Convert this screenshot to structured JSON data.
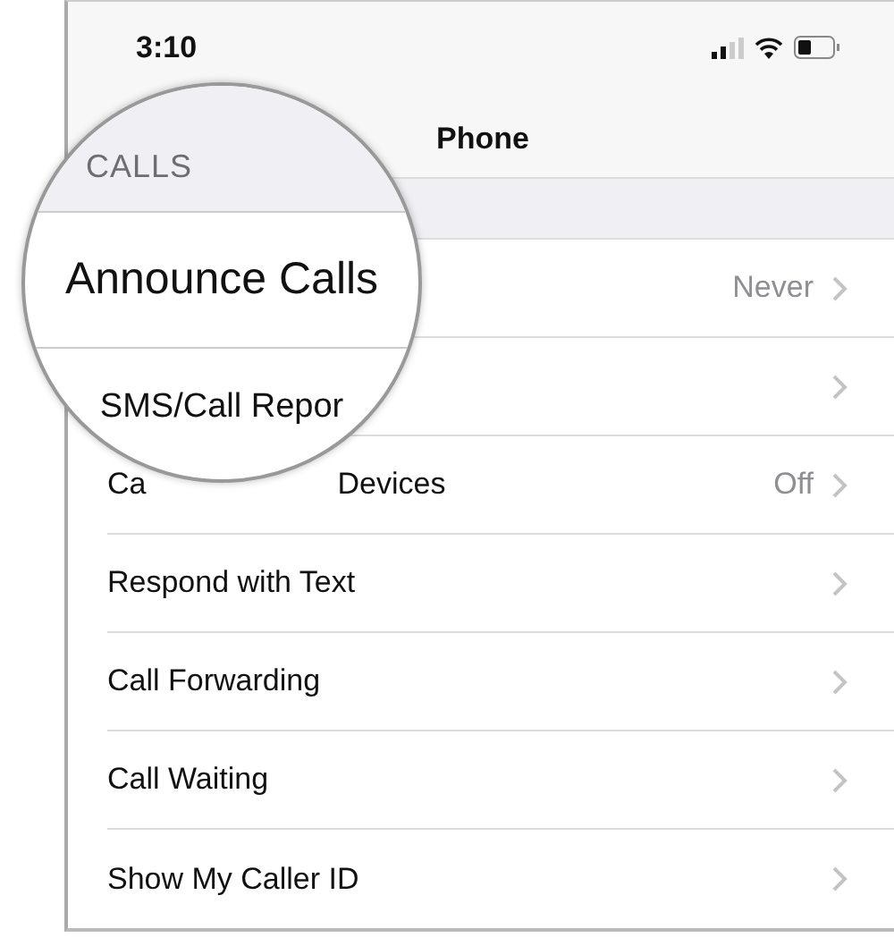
{
  "status_bar": {
    "time": "3:10"
  },
  "nav": {
    "title": "Phone"
  },
  "rows": [
    {
      "value": "Never"
    },
    {},
    {
      "label_parts": [
        "Ca",
        "Devices"
      ],
      "value": "Off"
    },
    {
      "label": "Respond with Text"
    },
    {
      "label": "Call Forwarding"
    },
    {
      "label": "Call Waiting"
    },
    {
      "label": "Show My Caller ID"
    }
  ],
  "magnifier": {
    "section_header": "CALLS",
    "rows": [
      "Announce Calls",
      "SMS/Call Repor"
    ]
  }
}
